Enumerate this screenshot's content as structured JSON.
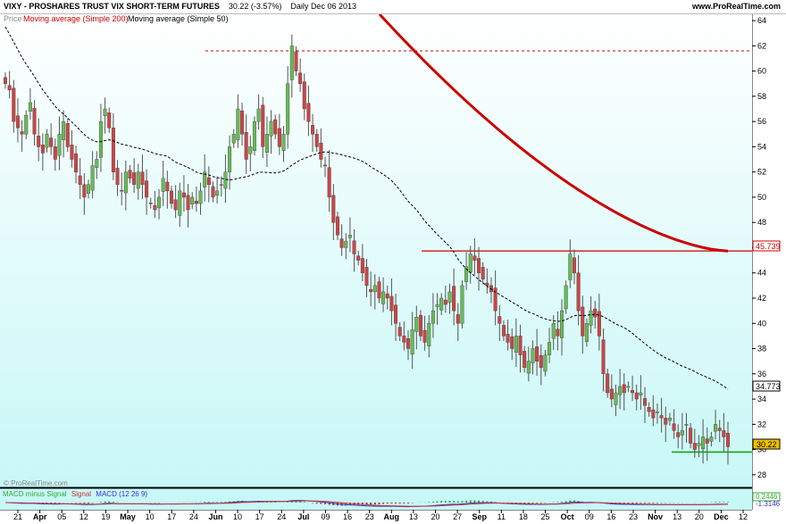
{
  "header": {
    "symbol_title": "VIXY - PROSHARES TRUST VIX SHORT-TERM FUTURES",
    "last_price": "30.22 (-3.57%)",
    "period": "Daily",
    "date": "Dec 06 2013",
    "site": "www.ProRealTime.com"
  },
  "legend": {
    "price": "Price",
    "ma200": "Moving average (Simple 200)",
    "ma50": "Moving average (Simple 50)"
  },
  "watermark": "© ProRealTime.com",
  "macd": {
    "label_hist": "MACD minus Signal",
    "label_signal": "Signal",
    "label_macd": "MACD (12 26 9)",
    "value_label": "0.2446",
    "value_label2": "-1.3146"
  },
  "colors": {
    "background_top": "#ffffff",
    "background_bottom": "#c8f7f7",
    "up_candle": "#66bb55",
    "down_candle": "#cc4444",
    "ma200": "#cc0000",
    "ma50": "#000000",
    "resistance": "#cc0000",
    "support": "#00aa00"
  },
  "chart_data": {
    "type": "candlestick",
    "y_ticks": [
      "64",
      "62",
      "60",
      "58",
      "56",
      "54",
      "52",
      "50",
      "48",
      "46",
      "44",
      "42",
      "40",
      "38",
      "36",
      "34",
      "32",
      "30",
      "28"
    ],
    "ylim": [
      27,
      64.5
    ],
    "x_ticks": [
      "21",
      "Apr",
      "05",
      "12",
      "19",
      "May",
      "10",
      "17",
      "24",
      "Jun",
      "10",
      "17",
      "24",
      "Jul",
      "09",
      "16",
      "23",
      "Aug",
      "13",
      "20",
      "27",
      "Sep",
      "11",
      "18",
      "25",
      "Oct",
      "09",
      "16",
      "23",
      "Nov",
      "13",
      "20",
      "Dec",
      "12"
    ],
    "value_labels": [
      "45.739",
      "34.773",
      "30.22"
    ],
    "levels": {
      "dashed_resistance": 61.6,
      "resistance": 45.739,
      "support": 29.8
    },
    "ma200": {
      "start": 64.5,
      "end": 45.739
    },
    "ma50": {
      "start": 63.5,
      "end": 34.773
    },
    "closes": [
      59,
      58.5,
      56,
      55.5,
      55,
      56.5,
      57.5,
      55,
      54,
      53.5,
      55,
      54,
      53,
      55,
      56,
      54,
      53,
      52,
      51,
      50,
      51,
      52.5,
      53,
      56,
      57,
      55.5,
      52,
      51,
      50.5,
      52,
      51.5,
      51,
      52,
      51,
      50,
      49.5,
      49,
      50,
      51.5,
      50.5,
      49.5,
      49,
      50.5,
      50,
      49,
      50,
      49.5,
      50.5,
      52,
      51,
      50,
      50.5,
      51,
      52,
      54,
      55,
      57,
      55,
      53,
      54,
      56,
      57,
      54,
      55,
      56,
      55,
      54,
      55,
      59,
      62,
      60,
      59,
      57,
      56,
      55,
      54,
      53,
      52.5,
      50,
      48,
      47,
      46,
      46.5,
      47,
      45.5,
      45,
      44,
      43,
      42.5,
      43,
      42,
      42.5,
      42,
      41,
      40,
      39,
      38.5,
      38,
      39.5,
      40.5,
      39,
      38.5,
      40,
      41,
      41.5,
      42,
      41.5,
      42.5,
      41,
      40,
      43,
      44.5,
      45.5,
      45,
      44,
      43.5,
      43,
      42.5,
      41,
      40,
      39,
      38.5,
      38,
      39,
      37.5,
      36.5,
      37,
      38,
      37,
      36.5,
      37.5,
      38.5,
      40,
      39,
      41,
      43,
      45.5,
      44,
      41,
      39,
      40,
      41,
      40.5,
      39,
      36,
      34.5,
      34,
      34.5,
      35,
      34.5,
      35,
      34.5,
      34,
      34.5,
      33.5,
      33,
      32.5,
      33,
      32.5,
      32,
      32.5,
      31.5,
      31,
      31.5,
      32,
      30.5,
      30,
      30.5,
      31,
      30.5,
      31,
      32,
      31.5,
      31,
      30.22
    ]
  }
}
